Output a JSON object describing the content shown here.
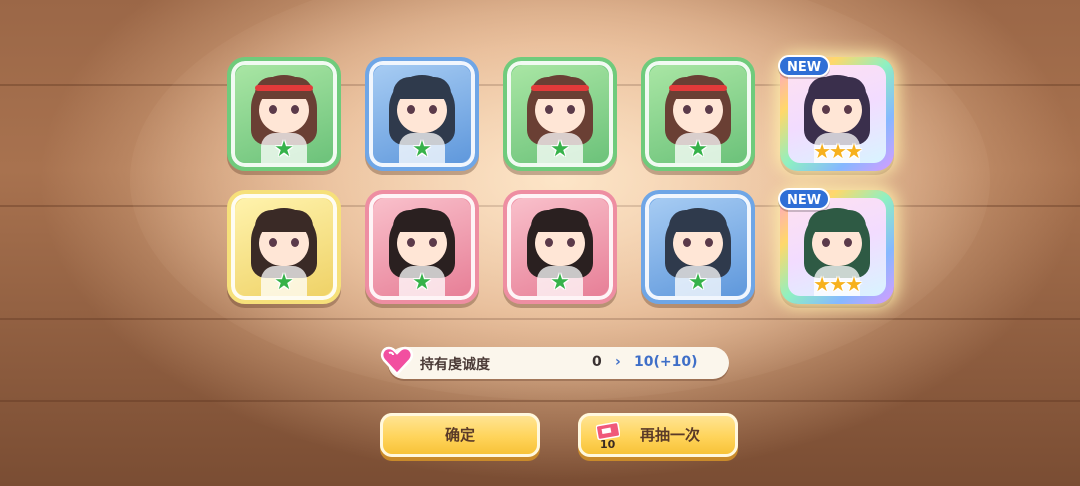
{
  "cards": [
    {
      "row": 1,
      "col": 1,
      "color": "green",
      "hair": "#6a3f34",
      "headband": true,
      "rarity": 1,
      "is_new": false
    },
    {
      "row": 1,
      "col": 2,
      "color": "blue",
      "hair": "#2f3a4c",
      "headband": false,
      "rarity": 1,
      "is_new": false
    },
    {
      "row": 1,
      "col": 3,
      "color": "green",
      "hair": "#6a3f34",
      "headband": true,
      "rarity": 1,
      "is_new": false
    },
    {
      "row": 1,
      "col": 4,
      "color": "green",
      "hair": "#6a3f34",
      "headband": true,
      "rarity": 1,
      "is_new": false
    },
    {
      "row": 1,
      "col": 5,
      "color": "rainbow",
      "hair": "#3a2f4c",
      "headband": false,
      "rarity": 3,
      "is_new": true
    },
    {
      "row": 2,
      "col": 1,
      "color": "yellow",
      "hair": "#3a2a26",
      "headband": false,
      "rarity": 1,
      "is_new": false
    },
    {
      "row": 2,
      "col": 2,
      "color": "pink",
      "hair": "#2a2020",
      "headband": false,
      "rarity": 1,
      "is_new": false
    },
    {
      "row": 2,
      "col": 3,
      "color": "pink",
      "hair": "#2a2020",
      "headband": false,
      "rarity": 1,
      "is_new": false
    },
    {
      "row": 2,
      "col": 4,
      "color": "blue",
      "hair": "#2f3a4c",
      "headband": false,
      "rarity": 1,
      "is_new": false
    },
    {
      "row": 2,
      "col": 5,
      "color": "rainbow",
      "hair": "#2e5a44",
      "headband": false,
      "rarity": 3,
      "is_new": true
    }
  ],
  "new_badge_label": "NEW",
  "affinity": {
    "label": "持有虔诚度",
    "from": "0",
    "arrow": "›",
    "to": "10(+10)"
  },
  "buttons": {
    "confirm": "确定",
    "draw_again": "再抽一次",
    "ticket_count": "10"
  },
  "colors": {
    "green_card": "#6fcb7c",
    "blue_card": "#6fa6e6",
    "yellow_card": "#f6e07a",
    "pink_card": "#ee8ea2",
    "button_yellow": "#ffd45a",
    "new_badge": "#2f6fd6",
    "accent_blue": "#3f6fc8"
  }
}
